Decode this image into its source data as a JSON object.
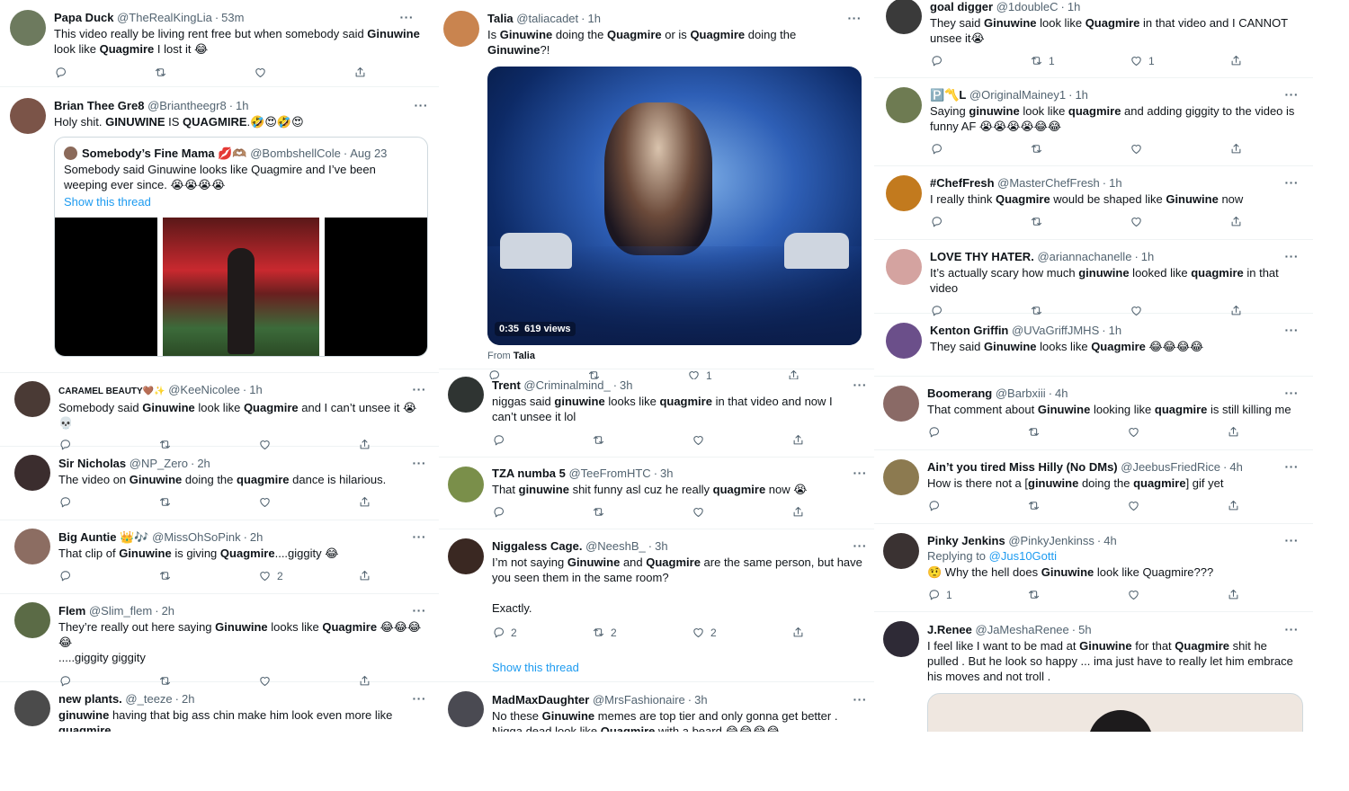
{
  "colors": {
    "link": "#1d9bf0",
    "text": "#0f1419",
    "muted": "#536471",
    "border": "#eff3f4"
  },
  "icons": {
    "more": "more-icon",
    "reply": "reply-icon",
    "retweet": "retweet-icon",
    "like": "like-icon",
    "share": "share-icon"
  },
  "col1": [
    {
      "name": "Papa Duck",
      "handle": "@TheRealKingLia",
      "time": "53m",
      "avatar": "#6d7a5e",
      "text_parts": [
        "This video really be living rent free but when somebody said ",
        "Ginuwine",
        " look like ",
        "Quagmire",
        " I lost it 😂"
      ],
      "counts": [
        "",
        "",
        "",
        ""
      ]
    },
    {
      "name": "Brian Thee Gre8",
      "handle": "@Briantheegr8",
      "time": "1h",
      "avatar": "#7b5448",
      "text_parts": [
        "Holy shit. ",
        "GINUWINE",
        " IS ",
        "QUAGMIRE",
        ".🤣😍🤣😍"
      ],
      "quote": {
        "name": "Somebody’s Fine Mama 💋🫶🏽",
        "handle": "@BombshellCole",
        "time": "Aug 23",
        "text": "Somebody said Ginuwine looks like Quagmire and I’ve been weeping ever since. 😭😭😭😭",
        "link": "Show this thread"
      }
    },
    {
      "name": "CARAMEL BEAUTY🤎✨",
      "handle": "@KeeNicolee",
      "time": "1h",
      "avatar": "#4a3a35",
      "text_parts": [
        "Somebody said ",
        "Ginuwine",
        " look like ",
        "Quagmire",
        " and I can’t unsee it 😭💀"
      ],
      "counts": [
        "",
        "",
        "",
        ""
      ]
    },
    {
      "name": "Sir Nicholas",
      "handle": "@NP_Zero",
      "time": "2h",
      "avatar": "#3b2d2e",
      "text_parts": [
        "The video on ",
        "Ginuwine",
        " doing the ",
        "quagmire",
        " dance is hilarious."
      ],
      "counts": [
        "",
        "",
        "",
        ""
      ]
    },
    {
      "name": "Big Auntie 👑🎶",
      "handle": "@MissOhSoPink",
      "time": "2h",
      "avatar": "#8c6d62",
      "text_parts": [
        "That clip of ",
        "Ginuwine",
        " is giving ",
        "Quagmire",
        "....giggity 😂"
      ],
      "counts": [
        "",
        "",
        "2",
        ""
      ]
    },
    {
      "name": "Flem",
      "handle": "@Slim_flem",
      "time": "2h",
      "avatar": "#5b6b46",
      "text_parts": [
        "They’re really out here saying ",
        "Ginuwine",
        " looks like ",
        "Quagmire",
        " 😂😂😂😂\n.....giggity giggity"
      ],
      "counts": [
        "",
        "",
        "",
        ""
      ]
    },
    {
      "name": "new plants.",
      "handle": "@_teeze",
      "time": "2h",
      "avatar": "#4b4b4b",
      "text_parts": [
        "",
        "ginuwine",
        " having that big ass chin make him look even more like ",
        "quagmire",
        ""
      ]
    }
  ],
  "col2": [
    {
      "name": "Talia",
      "handle": "@taliacadet",
      "time": "1h",
      "avatar": "#c9844f",
      "text_parts": [
        "Is ",
        "Ginuwine",
        " doing the ",
        "Quagmire",
        " or is ",
        "Quagmire",
        " doing the ",
        "Ginuwine",
        "?!"
      ],
      "video": {
        "duration": "0:35",
        "views": "619 views",
        "from_label": "From",
        "from_name": "Talia"
      },
      "counts": [
        "",
        "",
        "1",
        ""
      ]
    },
    {
      "name": "Trent",
      "handle": "@Criminalmind_",
      "time": "3h",
      "avatar": "#2f3432",
      "text_parts": [
        "niggas said ",
        "ginuwine",
        " looks like ",
        "quagmire",
        " in that video and now I can’t unsee it lol"
      ],
      "counts": [
        "",
        "",
        "",
        ""
      ]
    },
    {
      "name": "TZA numba 5",
      "handle": "@TeeFromHTC",
      "time": "3h",
      "avatar": "#7a8f4a",
      "text_parts": [
        "That ",
        "ginuwine",
        " shit funny asl cuz he really ",
        "quagmire",
        " now 😭"
      ],
      "counts": [
        "",
        "",
        "",
        ""
      ]
    },
    {
      "name": "Niggaless Cage.",
      "handle": "@NeeshB_",
      "time": "3h",
      "avatar": "#3a2822",
      "text_parts": [
        "I’m not saying ",
        "Ginuwine",
        " and ",
        "Quagmire",
        " are the same person, but have you seen them in the same room?\n\nExactly."
      ],
      "counts": [
        "2",
        "2",
        "2",
        ""
      ],
      "link": "Show this thread"
    },
    {
      "name": "MadMaxDaughter",
      "handle": "@MrsFashionaire",
      "time": "3h",
      "avatar": "#4a4a52",
      "text_parts": [
        "No these ",
        "Ginuwine",
        " memes are top tier and only gonna get better . Nigga dead look like ",
        "Quagmire",
        " with a beard 😂😂😂😂"
      ]
    }
  ],
  "col3": [
    {
      "name": "goal digger",
      "handle": "@1doubleC",
      "time": "1h",
      "avatar": "#3a3a3a",
      "text_parts": [
        "They said ",
        "Ginuwine",
        " look like ",
        "Quagmire",
        " in that video and I CANNOT unsee it😭"
      ],
      "counts": [
        "",
        "1",
        "1",
        ""
      ]
    },
    {
      "name": "🅿️〽️L",
      "handle": "@OriginalMainey1",
      "time": "1h",
      "avatar": "#6e7b52",
      "text_parts": [
        "Saying ",
        "ginuwine",
        " look like ",
        "quagmire",
        " and adding giggity to the video is funny AF 😭😭😭😭😂😂"
      ],
      "counts": [
        "",
        "",
        "",
        ""
      ]
    },
    {
      "name": "#ChefFresh",
      "handle": "@MasterChefFresh",
      "time": "1h",
      "avatar": "#c27a1e",
      "text_parts": [
        "I really think ",
        "Quagmire",
        " would be shaped like ",
        "Ginuwine",
        " now"
      ],
      "counts": [
        "",
        "",
        "",
        ""
      ]
    },
    {
      "name": "LOVE THY HATER.",
      "handle": "@ariannachanelle",
      "time": "1h",
      "avatar": "#d4a3a0",
      "text_parts": [
        "It’s actually scary how much ",
        "ginuwine",
        " looked like ",
        "quagmire",
        " in that video"
      ],
      "counts": [
        "",
        "",
        "",
        ""
      ]
    },
    {
      "name": "Kenton Griffin",
      "handle": "@UVaGriffJMHS",
      "time": "1h",
      "avatar": "#6b4f8a",
      "text_parts": [
        "They said ",
        "Ginuwine",
        " looks like ",
        "Quagmire",
        " 😂😂😂😂"
      ]
    },
    {
      "name": "Boomerang",
      "handle": "@Barbxiii",
      "time": "4h",
      "avatar": "#8a6a66",
      "text_parts": [
        "That comment about ",
        "Ginuwine",
        " looking like ",
        "quagmire",
        " is still killing me"
      ],
      "counts": [
        "",
        "",
        "",
        ""
      ]
    },
    {
      "name": "Ain’t you tired Miss Hilly (No DMs)",
      "handle": "@JeebusFriedRice",
      "time": "4h",
      "avatar": "#8c7a50",
      "text_parts": [
        "How is there not a [",
        "ginuwine",
        " doing the ",
        "quagmire",
        "] gif yet"
      ],
      "counts": [
        "",
        "",
        "",
        ""
      ]
    },
    {
      "name": "Pinky Jenkins",
      "handle": "@PinkyJenkinss",
      "time": "4h",
      "avatar": "#3a3232",
      "reply_label": "Replying to",
      "reply_handle": "@Jus10Gotti",
      "text_parts": [
        "🤨 Why the hell does ",
        "Ginuwine",
        " look like Quagmire???"
      ],
      "counts": [
        "1",
        "",
        "",
        ""
      ]
    },
    {
      "name": "J.Renee",
      "handle": "@JaMeshaRenee",
      "time": "5h",
      "avatar": "#2e2a36",
      "text_parts": [
        "I feel like I want to be mad at ",
        "Ginuwine",
        " for that ",
        "Quagmire",
        " shit he pulled . But he look so happy ... ima just have to really let him embrace his moves and not troll ."
      ]
    }
  ]
}
